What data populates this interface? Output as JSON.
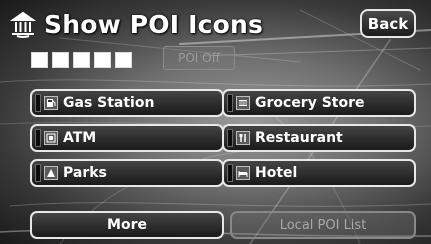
{
  "header": {
    "title": "Show POI Icons",
    "back_label": "Back",
    "icon": "landmark-icon"
  },
  "status": {
    "segments": 5,
    "label": "POI Off"
  },
  "poi_buttons": [
    {
      "label": "Gas Station",
      "icon": "gas-station-icon"
    },
    {
      "label": "Grocery Store",
      "icon": "grocery-store-icon"
    },
    {
      "label": "ATM",
      "icon": "atm-icon"
    },
    {
      "label": "Restaurant",
      "icon": "restaurant-icon"
    },
    {
      "label": "Parks",
      "icon": "parks-icon"
    },
    {
      "label": "Hotel",
      "icon": "hotel-icon"
    }
  ],
  "footer": {
    "more_label": "More",
    "local_list_label": "Local POI List"
  },
  "colors": {
    "button_border": "#e8e8e8",
    "disabled_text": "#9c9c9c"
  }
}
